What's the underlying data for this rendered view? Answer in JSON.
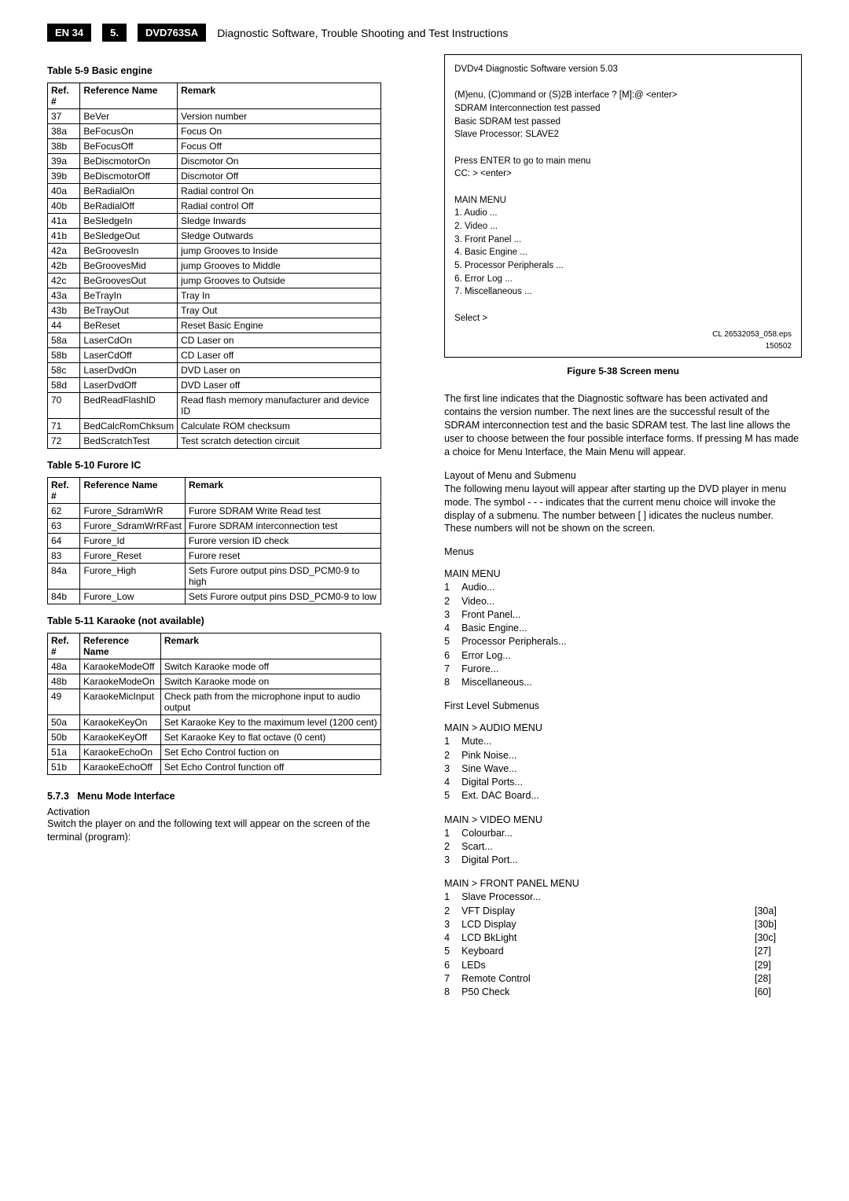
{
  "header": {
    "page_label": "EN 34",
    "section_num": "5.",
    "model": "DVD763SA",
    "title": "Diagnostic Software, Trouble Shooting and Test Instructions"
  },
  "table59": {
    "title": "Table 5-9 Basic engine",
    "headers": [
      "Ref. #",
      "Reference Name",
      "Remark"
    ],
    "rows": [
      [
        "37",
        "BeVer",
        "Version number"
      ],
      [
        "38a",
        "BeFocusOn",
        "Focus On"
      ],
      [
        "38b",
        "BeFocusOff",
        "Focus Off"
      ],
      [
        "39a",
        "BeDiscmotorOn",
        "Discmotor On"
      ],
      [
        "39b",
        "BeDiscmotorOff",
        "Discmotor Off"
      ],
      [
        "40a",
        "BeRadialOn",
        "Radial control On"
      ],
      [
        "40b",
        "BeRadialOff",
        "Radial control Off"
      ],
      [
        "41a",
        "BeSledgeIn",
        "Sledge Inwards"
      ],
      [
        "41b",
        "BeSledgeOut",
        "Sledge Outwards"
      ],
      [
        "42a",
        "BeGroovesIn",
        "jump Grooves to Inside"
      ],
      [
        "42b",
        "BeGroovesMid",
        "jump Grooves to Middle"
      ],
      [
        "42c",
        "BeGroovesOut",
        "jump Grooves to Outside"
      ],
      [
        "43a",
        "BeTrayIn",
        "Tray In"
      ],
      [
        "43b",
        "BeTrayOut",
        "Tray Out"
      ],
      [
        "44",
        "BeReset",
        "Reset Basic Engine"
      ],
      [
        "58a",
        "LaserCdOn",
        "CD Laser on"
      ],
      [
        "58b",
        "LaserCdOff",
        "CD Laser off"
      ],
      [
        "58c",
        "LaserDvdOn",
        "DVD Laser on"
      ],
      [
        "58d",
        "LaserDvdOff",
        "DVD Laser off"
      ],
      [
        "70",
        "BedReadFlashID",
        "Read flash memory manufacturer and device ID"
      ],
      [
        "71",
        "BedCalcRomChksum",
        "Calculate ROM checksum"
      ],
      [
        "72",
        "BedScratchTest",
        "Test scratch detection circuit"
      ]
    ]
  },
  "table510": {
    "title": "Table 5-10 Furore IC",
    "headers": [
      "Ref. #",
      "Reference Name",
      "Remark"
    ],
    "rows": [
      [
        "62",
        "Furore_SdramWrR",
        "Furore SDRAM Write Read test"
      ],
      [
        "63",
        "Furore_SdramWrRFast",
        "Furore SDRAM interconnection test"
      ],
      [
        "64",
        "Furore_Id",
        "Furore version ID check"
      ],
      [
        "83",
        "Furore_Reset",
        "Furore reset"
      ],
      [
        "84a",
        "Furore_High",
        "Sets Furore output pins DSD_PCM0-9 to high"
      ],
      [
        "84b",
        "Furore_Low",
        "Sets Furore output pins DSD_PCM0-9 to low"
      ]
    ]
  },
  "table511": {
    "title": "Table 5-11 Karaoke (not available)",
    "headers": [
      "Ref. #",
      "Reference Name",
      "Remark"
    ],
    "rows": [
      [
        "48a",
        "KaraokeModeOff",
        "Switch Karaoke mode off"
      ],
      [
        "48b",
        "KaraokeModeOn",
        "Switch Karaoke mode on"
      ],
      [
        "49",
        "KaraokeMicInput",
        "Check path from the microphone input to audio output"
      ],
      [
        "50a",
        "KaraokeKeyOn",
        "Set Karaoke Key to the maximum level (1200 cent)"
      ],
      [
        "50b",
        "KaraokeKeyOff",
        "Set Karaoke Key to flat octave (0 cent)"
      ],
      [
        "51a",
        "KaraokeEchoOn",
        "Set Echo Control fuction on"
      ],
      [
        "51b",
        "KaraokeEchoOff",
        "Set Echo Control function off"
      ]
    ]
  },
  "menu_mode": {
    "num": "5.7.3",
    "title": "Menu Mode Interface",
    "activation_label": "Activation",
    "activation_text": "Switch the player on and the following text will appear on the screen of the terminal (program):"
  },
  "screen": {
    "line1": "DVDv4 Diagnostic Software version 5.03",
    "line2": "(M)enu, (C)ommand or (S)2B interface ? [M]:@ <enter>",
    "line3": "SDRAM Interconnection test passed",
    "line4": "Basic SDRAM test passed",
    "line5": "Slave Processor: SLAVE2",
    "line6": "Press ENTER to go to main menu",
    "line7": "CC: > <enter>",
    "line8": "MAIN MENU",
    "items": [
      "1. Audio ...",
      "2. Video ...",
      "3. Front Panel ...",
      "4. Basic Engine ...",
      "5. Processor Peripherals ...",
      "6. Error Log ...",
      "7. Miscellaneous ..."
    ],
    "select": "Select >",
    "note1": "CL 26532053_058.eps",
    "note2": "150502"
  },
  "fig_caption": "Figure 5-38 Screen menu",
  "para1": "The first line indicates that the Diagnostic software has been activated and contains the version number. The next lines are the successful result of the SDRAM interconnection test and the basic SDRAM test. The last line allows the user to choose between the four possible interface forms. If pressing M has made a choice for Menu Interface, the Main Menu will appear.",
  "layout_title": "Layout of Menu and Submenu",
  "para2": "The following menu layout will appear after starting up the DVD player in menu mode. The symbol - - - indicates that the current menu choice will invoke the display of a submenu. The number between [ ] idicates the nucleus number. These numbers will not be shown on the screen.",
  "menus_label": "Menus",
  "main_menu": {
    "title": "MAIN MENU",
    "items": [
      {
        "n": "1",
        "label": "Audio..."
      },
      {
        "n": "2",
        "label": "Video..."
      },
      {
        "n": "3",
        "label": "Front Panel..."
      },
      {
        "n": "4",
        "label": "Basic Engine..."
      },
      {
        "n": "5",
        "label": "Processor Peripherals..."
      },
      {
        "n": "6",
        "label": "Error Log..."
      },
      {
        "n": "7",
        "label": "Furore..."
      },
      {
        "n": "8",
        "label": "Miscellaneous..."
      }
    ]
  },
  "first_level_label": "First Level Submenus",
  "audio_menu": {
    "title": "MAIN > AUDIO MENU",
    "items": [
      {
        "n": "1",
        "label": "Mute..."
      },
      {
        "n": "2",
        "label": "Pink Noise..."
      },
      {
        "n": "3",
        "label": "Sine Wave..."
      },
      {
        "n": "4",
        "label": "Digital Ports..."
      },
      {
        "n": "5",
        "label": "Ext. DAC Board..."
      }
    ]
  },
  "video_menu": {
    "title": "MAIN > VIDEO MENU",
    "items": [
      {
        "n": "1",
        "label": "Colourbar..."
      },
      {
        "n": "2",
        "label": "Scart..."
      },
      {
        "n": "3",
        "label": "Digital Port..."
      }
    ]
  },
  "front_panel_menu": {
    "title": "MAIN > FRONT PANEL MENU",
    "items": [
      {
        "n": "1",
        "label": "Slave Processor...",
        "ref": ""
      },
      {
        "n": "2",
        "label": "VFT Display",
        "ref": "[30a]"
      },
      {
        "n": "3",
        "label": "LCD Display",
        "ref": "[30b]"
      },
      {
        "n": "4",
        "label": "LCD BkLight",
        "ref": "[30c]"
      },
      {
        "n": "5",
        "label": "Keyboard",
        "ref": "[27]"
      },
      {
        "n": "6",
        "label": "LEDs",
        "ref": "[29]"
      },
      {
        "n": "7",
        "label": "Remote Control",
        "ref": "[28]"
      },
      {
        "n": "8",
        "label": "P50 Check",
        "ref": "[60]"
      }
    ]
  }
}
